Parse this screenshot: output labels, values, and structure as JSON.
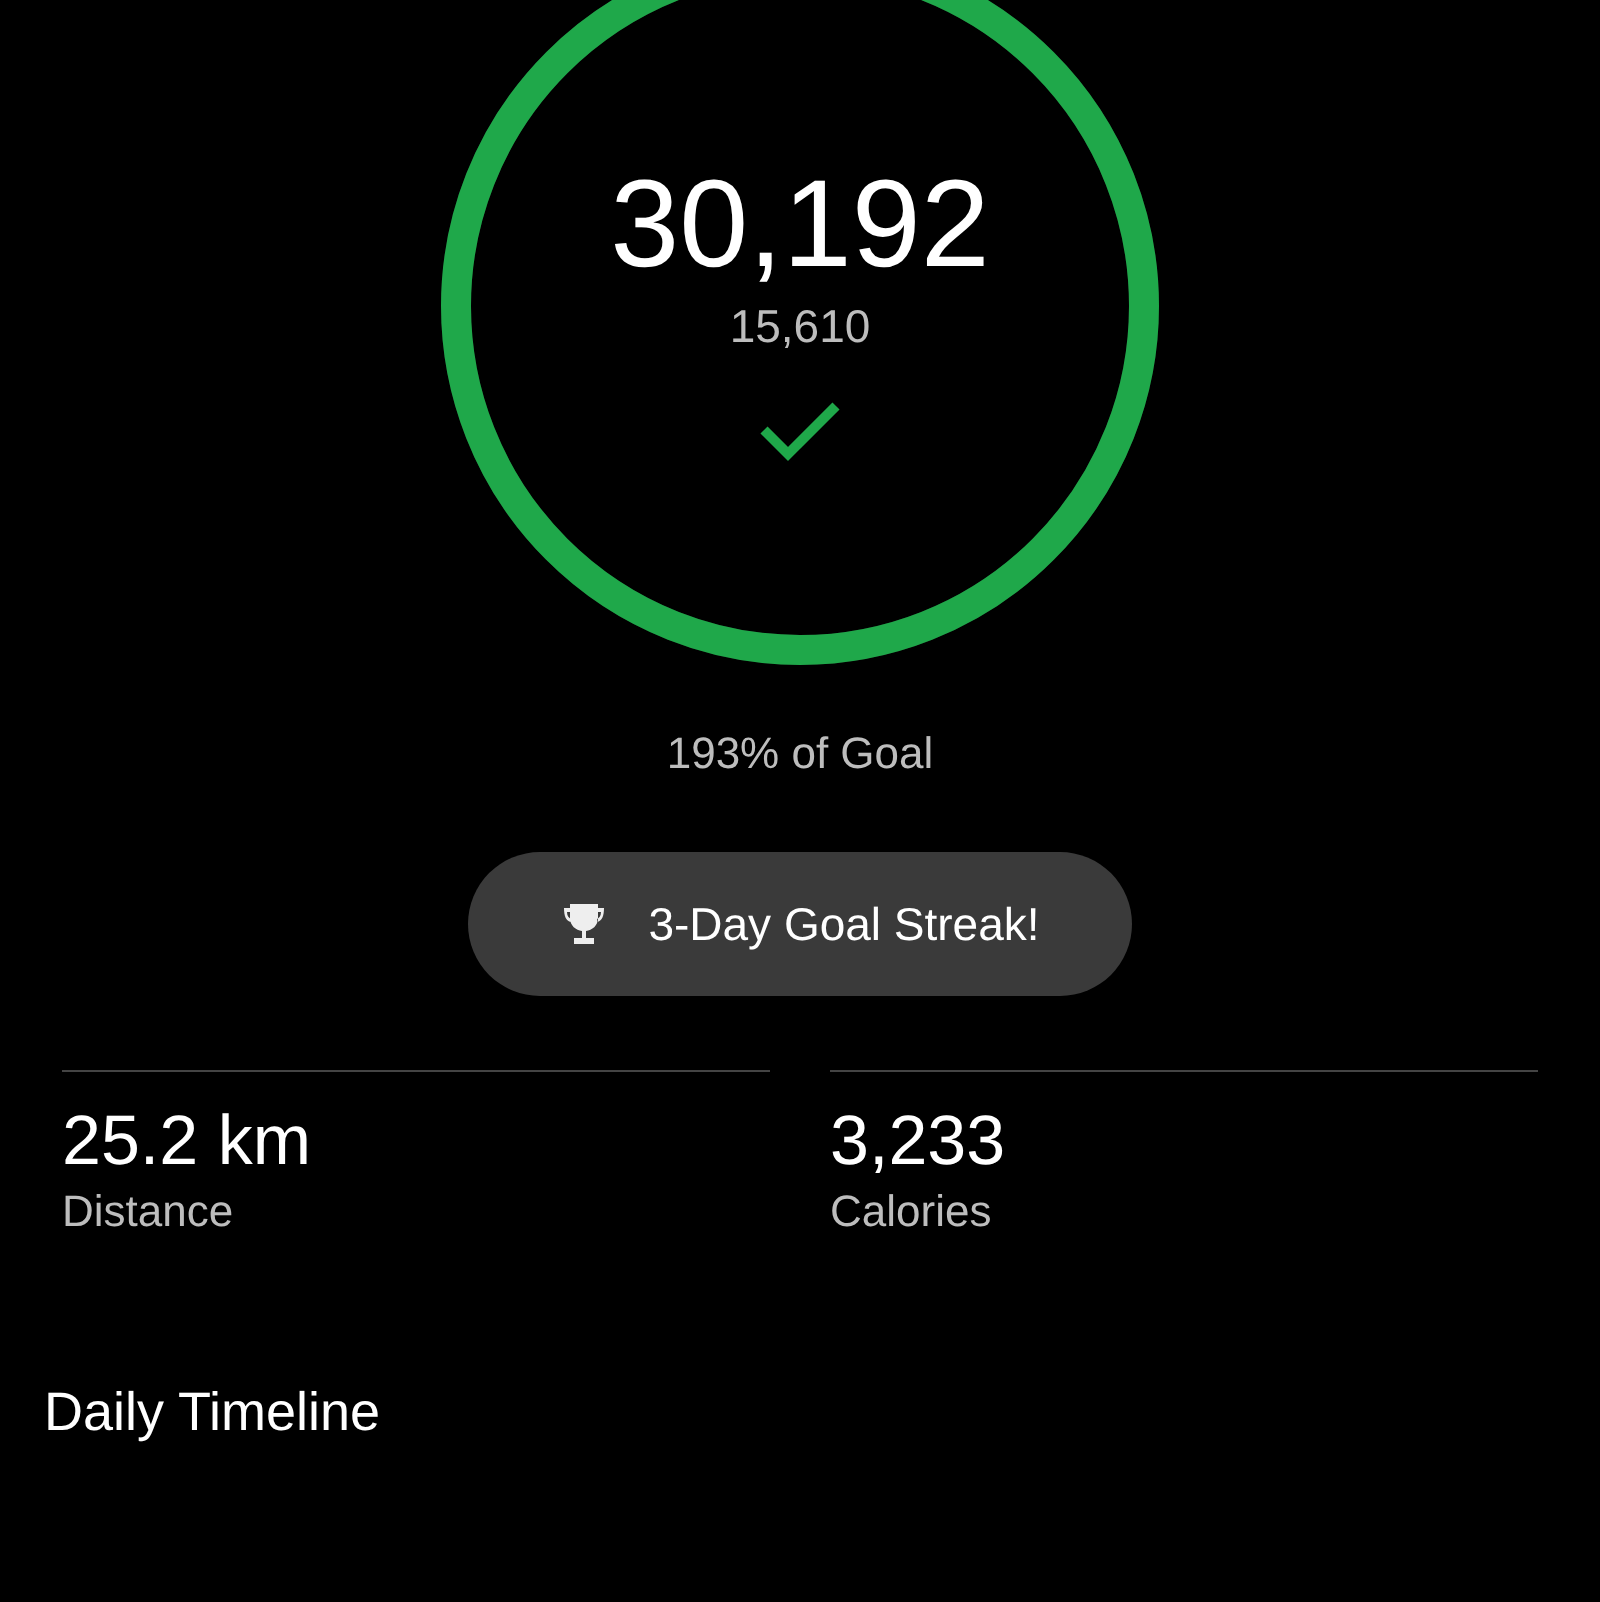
{
  "goal_ring": {
    "steps": "30,192",
    "goal": "15,610",
    "goal_met": true
  },
  "goal_percent": "193% of Goal",
  "streak_badge": {
    "label": "3-Day Goal Streak!"
  },
  "stats": [
    {
      "value": "25.2 km",
      "label": "Distance"
    },
    {
      "value": "3,233",
      "label": "Calories"
    }
  ],
  "section_title": "Daily Timeline"
}
